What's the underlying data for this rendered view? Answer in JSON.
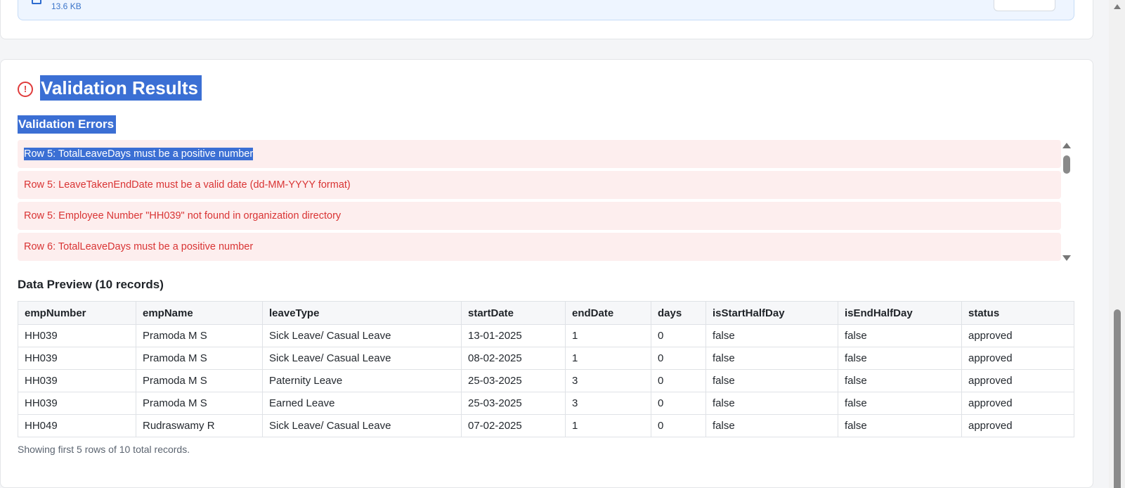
{
  "upload": {
    "file_size": "13.6 KB"
  },
  "validation": {
    "title": "Validation Results",
    "errors_heading": "Validation Errors",
    "errors": [
      "Row 5: TotalLeaveDays must be a positive number",
      "Row 5: LeaveTakenEndDate must be a valid date (dd-MM-YYYY format)",
      "Row 5: Employee Number \"HH039\" not found in organization directory",
      "Row 6: TotalLeaveDays must be a positive number"
    ],
    "selected_error_index": 0
  },
  "preview": {
    "title": "Data Preview (10 records)",
    "columns": [
      "empNumber",
      "empName",
      "leaveType",
      "startDate",
      "endDate",
      "days",
      "isStartHalfDay",
      "isEndHalfDay",
      "status"
    ],
    "rows": [
      [
        "HH039",
        "Pramoda M S",
        "Sick Leave/ Casual Leave",
        "13-01-2025",
        "1",
        "0",
        "false",
        "false",
        "approved"
      ],
      [
        "HH039",
        "Pramoda M S",
        "Sick Leave/ Casual Leave",
        "08-02-2025",
        "1",
        "0",
        "false",
        "false",
        "approved"
      ],
      [
        "HH039",
        "Pramoda M S",
        "Paternity Leave",
        "25-03-2025",
        "3",
        "0",
        "false",
        "false",
        "approved"
      ],
      [
        "HH039",
        "Pramoda M S",
        "Earned Leave",
        "25-03-2025",
        "3",
        "0",
        "false",
        "false",
        "approved"
      ],
      [
        "HH049",
        "Rudraswamy R",
        "Sick Leave/ Casual Leave",
        "07-02-2025",
        "1",
        "0",
        "false",
        "false",
        "approved"
      ]
    ],
    "footnote": "Showing first 5 rows of 10 total records."
  },
  "icons": {
    "alert": "alert-circle-icon",
    "file": "file-icon"
  },
  "colors": {
    "error_text": "#d93434",
    "error_bg": "#fdeeee",
    "selection": "#3b6fd4"
  }
}
